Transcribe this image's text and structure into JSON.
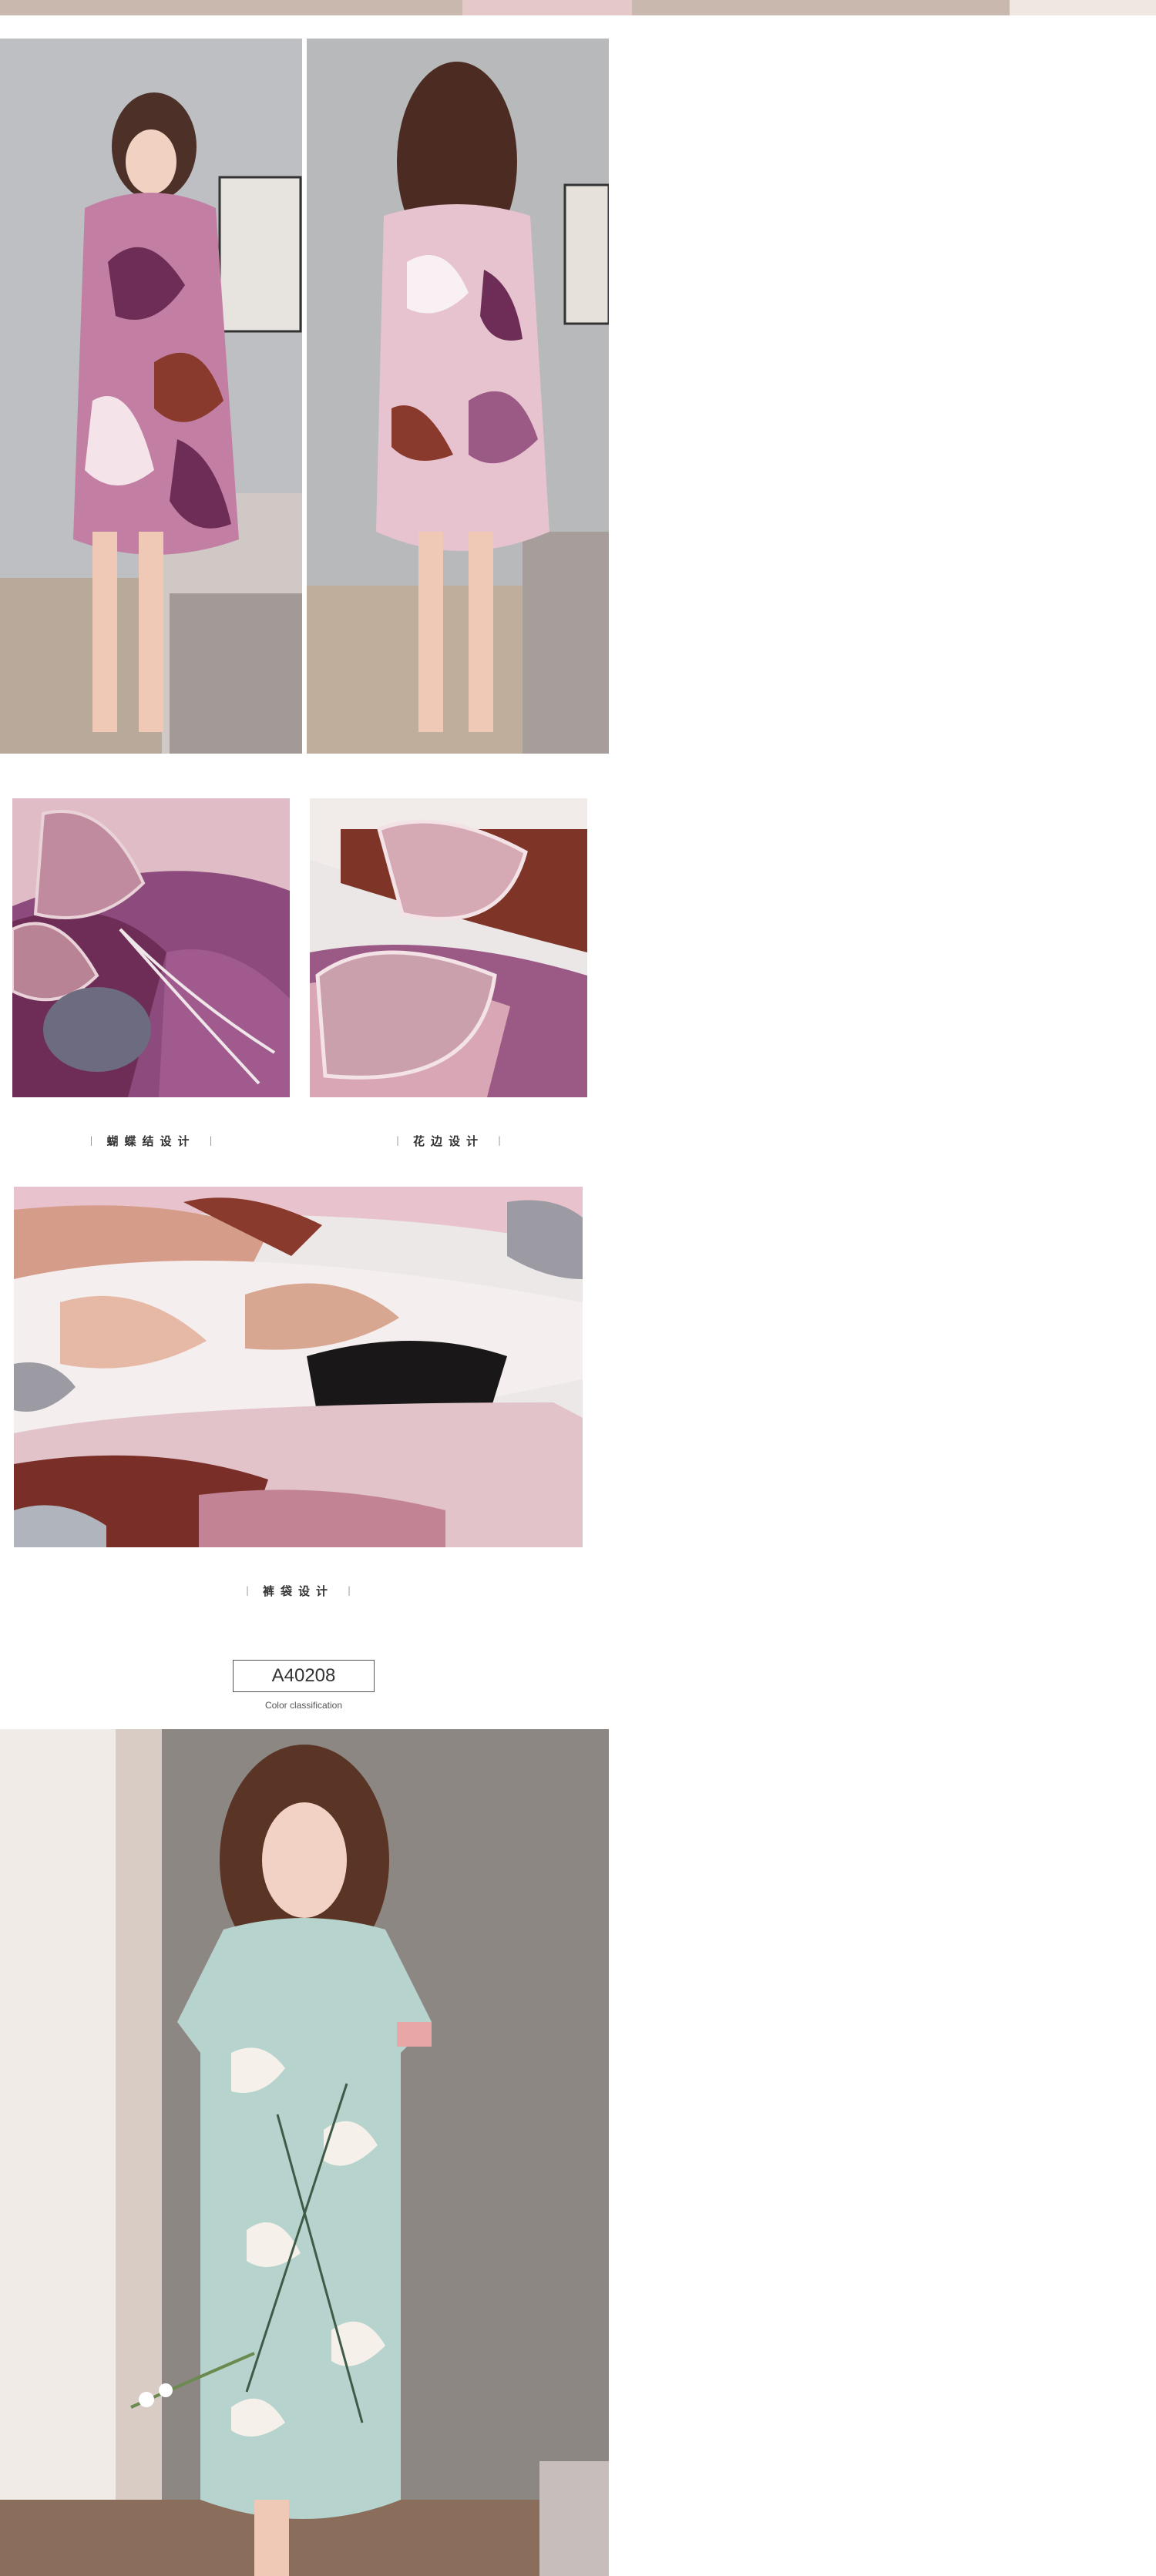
{
  "top_strip": {
    "icon": "photo-banner-fragment"
  },
  "section_model_photos": {
    "front_photo": {
      "icon": "model-front-photo",
      "dress_color": "#c27fa3"
    },
    "back_photo": {
      "icon": "model-back-photo",
      "dress_color": "#d29fb6"
    }
  },
  "section_details": {
    "bow_caption": "蝴蝶结设计",
    "lace_caption": "花边设计",
    "pocket_caption": "裤袋设计",
    "tick_left": "|",
    "tick_right": "|"
  },
  "color_block": {
    "code": "A40208",
    "label": "Color classification"
  },
  "section_final_photo": {
    "icon": "model-green-dress-photo",
    "dress_color": "#b9d6cf"
  },
  "colors": {
    "mauve": "#9b5a86",
    "pink": "#e8c2cc",
    "plum": "#6d2d57",
    "brown": "#8a3a2c",
    "mint": "#b6d3cd"
  }
}
